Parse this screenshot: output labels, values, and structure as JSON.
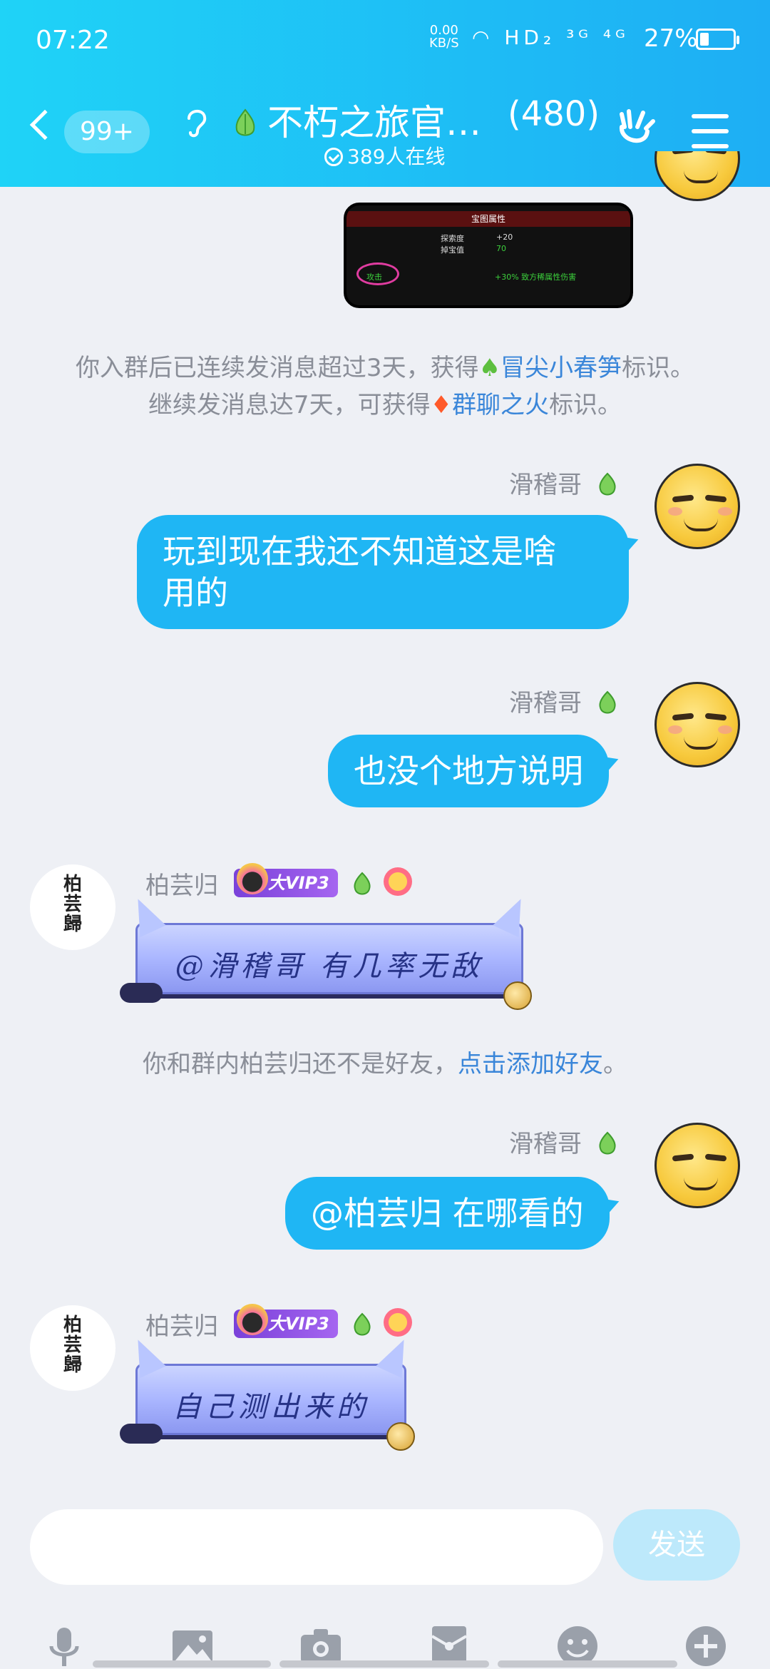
{
  "status_bar": {
    "time": "07:22",
    "net_speed_value": "0.00",
    "net_speed_unit": "KB/S",
    "signal_icons": "HD₂ ³ᴳ ⁴ᴳ",
    "battery_percent": "27%",
    "battery_level": 0.27
  },
  "header": {
    "unread_count": "99+",
    "title": "不朽之旅官…",
    "member_count": "(480)",
    "online_text": "389人在线"
  },
  "messages": [
    {
      "type": "image",
      "side": "right",
      "image_header": "宝图属性",
      "rows": [
        "探索度",
        "+20",
        "掉宝值",
        "70",
        "攻击",
        "+30% 致方稀属性伤害"
      ]
    },
    {
      "type": "system",
      "line1_prefix": "你入群后已连续发消息超过3天，获得",
      "line1_link": "冒尖小春笋",
      "line1_suffix": "标识。",
      "line2_prefix": "继续发消息达7天，可获得",
      "line2_link": "群聊之火",
      "line2_suffix": "标识。"
    },
    {
      "type": "text",
      "side": "right",
      "sender": "滑稽哥",
      "text_line1": "玩到现在我还不知道这是啥",
      "text_line2": "用的"
    },
    {
      "type": "text",
      "side": "right",
      "sender": "滑稽哥",
      "text": "也没个地方说明"
    },
    {
      "type": "banner",
      "side": "left",
      "sender": "柏芸归",
      "vip": "大VIP3",
      "text": "@滑稽哥 有几率无敌"
    },
    {
      "type": "system",
      "prefix": "你和群内柏芸归还不是好友，",
      "link": "点击添加好友",
      "suffix": "。"
    },
    {
      "type": "text",
      "side": "right",
      "sender": "滑稽哥",
      "text": "@柏芸归 在哪看的"
    },
    {
      "type": "banner",
      "side": "left",
      "sender": "柏芸归",
      "vip": "大VIP3",
      "text": "自己测出来的"
    }
  ],
  "avatar_calligraphy": [
    "柏",
    "芸",
    "歸"
  ],
  "input": {
    "send_label": "发送"
  },
  "icons": [
    "back-icon",
    "ear-icon",
    "sprout-icon",
    "hand-icon",
    "menu-icon",
    "mic-icon",
    "image-icon",
    "camera-icon",
    "redpacket-icon",
    "emoji-icon",
    "plus-icon"
  ],
  "colors": {
    "header_start": "#1fd3f7",
    "header_end": "#1eaef4",
    "bubble": "#1fb6f4",
    "link": "#3a86d9",
    "background": "#eef0f5"
  }
}
